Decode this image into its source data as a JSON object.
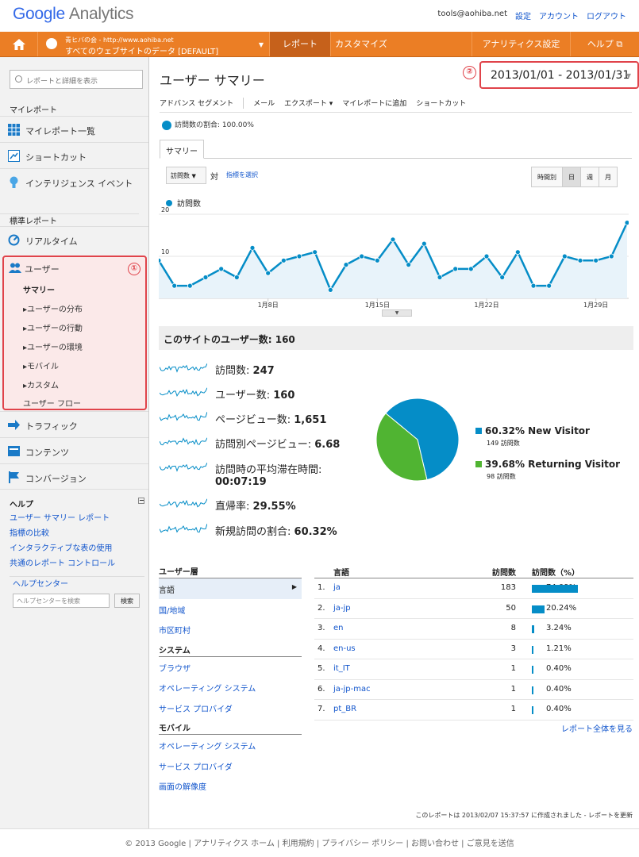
{
  "header": {
    "logo_google": "Google",
    "logo_product": "Analytics",
    "user_email": "tools@aohiba.net",
    "settings": "設定",
    "account": "アカウント",
    "logout": "ログアウト"
  },
  "navbar": {
    "profile_line1": "青ヒバの会 - http://www.aohiba.net",
    "profile_line2": "すべてのウェブサイトのデータ [DEFAULT]",
    "tab_report": "レポート",
    "tab_customize": "カスタマイズ",
    "tab_admin": "アナリティクス設定",
    "tab_help": "ヘルプ"
  },
  "sidebar": {
    "search_placeholder": "レポートと詳細を表示",
    "my_reports_title": "マイレポート",
    "my_reports_list": "マイレポート一覧",
    "shortcuts": "ショートカット",
    "intelligence": "インテリジェンス イベント",
    "standard_title": "標準レポート",
    "realtime": "リアルタイム",
    "users": "ユーザー",
    "users_sub": [
      "サマリー",
      "ユーザーの分布",
      "ユーザーの行動",
      "ユーザーの環境",
      "モバイル",
      "カスタム",
      "ユーザー フロー"
    ],
    "traffic": "トラフィック",
    "content": "コンテンツ",
    "conversion": "コンバージョン",
    "help_title": "ヘルプ",
    "help_links": [
      "ユーザー サマリー レポート",
      "指標の比較",
      "インタラクティブな表の使用",
      "共通のレポート コントロール"
    ],
    "help_center": "ヘルプセンター",
    "help_search_placeholder": "ヘルプセンターを検索",
    "help_search_button": "検索",
    "marker1": "①"
  },
  "main": {
    "title": "ユーザー サマリー",
    "date_range": "2013/01/01 - 2013/01/31",
    "marker2": "②",
    "toolbar": [
      "アドバンス セグメント",
      "メール",
      "エクスポート ▾",
      "マイレポートに追加",
      "ショートカット"
    ],
    "visits_pct": "訪問数の割合: 100.00%",
    "tab_summary": "サマリー",
    "metric_select": "訪問数",
    "vs": "対",
    "pick_metric": "指標を選択",
    "granularity": [
      "時間別",
      "日",
      "週",
      "月"
    ],
    "series_label": "訪問数",
    "overview_title": "このサイトのユーザー数: 160",
    "more_link": "レポート全体を見る",
    "footnote": "このレポートは 2013/02/07 15:37:57 に作成されました - レポートを更新"
  },
  "chart_data": {
    "type": "line",
    "x": [
      "1/1",
      "1/2",
      "1/3",
      "1/4",
      "1/5",
      "1/6",
      "1/7",
      "1/8",
      "1/9",
      "1/10",
      "1/11",
      "1/12",
      "1/13",
      "1/14",
      "1/15",
      "1/16",
      "1/17",
      "1/18",
      "1/19",
      "1/20",
      "1/21",
      "1/22",
      "1/23",
      "1/24",
      "1/25",
      "1/26",
      "1/27",
      "1/28",
      "1/29",
      "1/30",
      "1/31"
    ],
    "x_tick_labels": [
      "1月8日",
      "1月15日",
      "1月22日",
      "1月29日"
    ],
    "y_tick_labels": [
      "20",
      "10"
    ],
    "series": [
      {
        "name": "訪問数",
        "values": [
          9,
          3,
          3,
          5,
          7,
          5,
          12,
          6,
          9,
          10,
          11,
          2,
          8,
          10,
          9,
          14,
          8,
          13,
          5,
          7,
          7,
          10,
          5,
          11,
          3,
          3,
          10,
          9,
          9,
          10,
          18
        ]
      }
    ],
    "ylim": [
      0,
      20
    ],
    "color": "#058dc7"
  },
  "metrics": [
    {
      "label": "訪問数:",
      "value": "247"
    },
    {
      "label": "ユーザー数:",
      "value": "160"
    },
    {
      "label": "ページビュー数:",
      "value": "1,651"
    },
    {
      "label": "訪問別ページビュー:",
      "value": "6.68"
    },
    {
      "label": "訪問時の平均滞在時間:",
      "value": "00:07:19"
    },
    {
      "label": "直帰率:",
      "value": "29.55%"
    },
    {
      "label": "新規訪問の割合:",
      "value": "60.32%"
    }
  ],
  "pie_data": {
    "type": "pie",
    "slices": [
      {
        "pct": "60.32%",
        "label": "New Visitor",
        "sub": "149 訪問数",
        "value": 60.32,
        "color": "#058dc7"
      },
      {
        "pct": "39.68%",
        "label": "Returning Visitor",
        "sub": "98 訪問数",
        "value": 39.68,
        "color": "#50b432"
      }
    ]
  },
  "dimensions": {
    "groups": [
      {
        "title": "ユーザー層",
        "items": [
          "言語",
          "国/地域",
          "市区町村"
        ]
      },
      {
        "title": "システム",
        "items": [
          "ブラウザ",
          "オペレーティング システム",
          "サービス プロバイダ"
        ]
      },
      {
        "title": "モバイル",
        "items": [
          "オペレーティング システム",
          "サービス プロバイダ",
          "画面の解像度"
        ]
      }
    ]
  },
  "table": {
    "headers": [
      "言語",
      "訪問数",
      "訪問数（%）"
    ],
    "rows": [
      {
        "n": "1.",
        "lang": "ja",
        "visits": "183",
        "pct": "74.09%",
        "frac": 0.7409
      },
      {
        "n": "2.",
        "lang": "ja-jp",
        "visits": "50",
        "pct": "20.24%",
        "frac": 0.2024
      },
      {
        "n": "3.",
        "lang": "en",
        "visits": "8",
        "pct": "3.24%",
        "frac": 0.0324
      },
      {
        "n": "4.",
        "lang": "en-us",
        "visits": "3",
        "pct": "1.21%",
        "frac": 0.0121
      },
      {
        "n": "5.",
        "lang": "it_IT",
        "visits": "1",
        "pct": "0.40%",
        "frac": 0.004
      },
      {
        "n": "6.",
        "lang": "ja-jp-mac",
        "visits": "1",
        "pct": "0.40%",
        "frac": 0.004
      },
      {
        "n": "7.",
        "lang": "pt_BR",
        "visits": "1",
        "pct": "0.40%",
        "frac": 0.004
      }
    ]
  },
  "footer": "© 2013 Google | アナリティクス ホーム | 利用規約 | プライバシー ポリシー | お問い合わせ | ご意見を送信",
  "colors": {
    "accent": "#eb7e25",
    "link": "#1155cc",
    "series": "#058dc7",
    "returning": "#50b432",
    "highlight": "#e0434a"
  }
}
